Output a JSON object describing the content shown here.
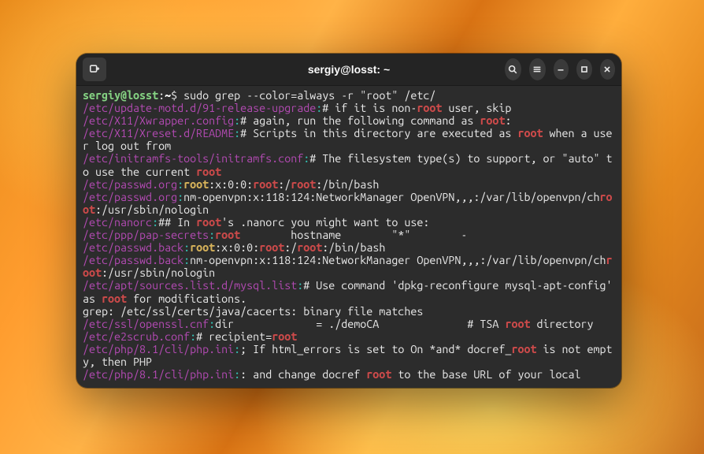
{
  "titlebar": {
    "title": "sergiy@losst: ~"
  },
  "prompt": {
    "user_host": "sergiy@losst",
    "separator": ":",
    "path": "~",
    "symbol": "$",
    "command": "sudo grep --color=always -r \"root\" /etc/"
  },
  "lines": [
    {
      "file": "/etc/update-motd.d/91-release-upgrade",
      "segments": [
        {
          "t": "# if it is non-",
          "c": "w"
        },
        {
          "t": "root",
          "c": "rb"
        },
        {
          "t": " user, skip",
          "c": "w"
        }
      ]
    },
    {
      "file": "/etc/X11/Xwrapper.config",
      "segments": [
        {
          "t": "# again, run the following command as ",
          "c": "w"
        },
        {
          "t": "root",
          "c": "rb"
        },
        {
          "t": ":",
          "c": "w"
        }
      ]
    },
    {
      "file": "/etc/X11/Xreset.d/README",
      "segments": [
        {
          "t": "# Scripts in this directory are executed as ",
          "c": "w"
        },
        {
          "t": "root",
          "c": "rb"
        },
        {
          "t": " when a user log out from",
          "c": "w"
        }
      ]
    },
    {
      "file": "/etc/initramfs-tools/initramfs.conf",
      "segments": [
        {
          "t": "# The filesystem type(s) to support, or \"auto\" to use the current ",
          "c": "w"
        },
        {
          "t": "root",
          "c": "rb"
        }
      ]
    },
    {
      "file": "/etc/passwd.org",
      "segments": [
        {
          "t": "root",
          "c": "yb"
        },
        {
          "t": ":x:0:0:",
          "c": "w"
        },
        {
          "t": "root",
          "c": "rb"
        },
        {
          "t": ":/",
          "c": "w"
        },
        {
          "t": "root",
          "c": "rb"
        },
        {
          "t": ":/bin/bash",
          "c": "w"
        }
      ]
    },
    {
      "file": "/etc/passwd.org",
      "segments": [
        {
          "t": "nm-openvpn:x:118:124:NetworkManager OpenVPN,,,:/var/lib/openvpn/ch",
          "c": "w"
        },
        {
          "t": "root",
          "c": "rb"
        },
        {
          "t": ":/usr/sbin/nologin",
          "c": "w"
        }
      ]
    },
    {
      "file": "/etc/nanorc",
      "segments": [
        {
          "t": "## In ",
          "c": "w"
        },
        {
          "t": "root",
          "c": "rb"
        },
        {
          "t": "'s .nanorc you might want to use:",
          "c": "w"
        }
      ]
    },
    {
      "file": "/etc/ppp/pap-secrets",
      "segments": [
        {
          "t": "root",
          "c": "rb"
        },
        {
          "t": "        hostname        \"*\"        -",
          "c": "w"
        }
      ]
    },
    {
      "file": "/etc/passwd.back",
      "segments": [
        {
          "t": "root",
          "c": "yb"
        },
        {
          "t": ":x:0:0:",
          "c": "w"
        },
        {
          "t": "root",
          "c": "rb"
        },
        {
          "t": ":/",
          "c": "w"
        },
        {
          "t": "root",
          "c": "rb"
        },
        {
          "t": ":/bin/bash",
          "c": "w"
        }
      ]
    },
    {
      "file": "/etc/passwd.back",
      "segments": [
        {
          "t": "nm-openvpn:x:118:124:NetworkManager OpenVPN,,,:/var/lib/openvpn/ch",
          "c": "w"
        },
        {
          "t": "root",
          "c": "rb"
        },
        {
          "t": ":/usr/sbin/nologin",
          "c": "w"
        }
      ]
    },
    {
      "file": "/etc/apt/sources.list.d/mysql.list",
      "segments": [
        {
          "t": "# Use command 'dpkg-reconfigure mysql-apt-config' as ",
          "c": "w"
        },
        {
          "t": "root",
          "c": "rb"
        },
        {
          "t": " for modifications.",
          "c": "w"
        }
      ]
    },
    {
      "plain": "grep: /etc/ssl/certs/java/cacerts: binary file matches"
    },
    {
      "file": "/etc/ssl/openssl.cnf",
      "segments": [
        {
          "t": "dir             = ./demoCA              # TSA ",
          "c": "w"
        },
        {
          "t": "root",
          "c": "rb"
        },
        {
          "t": " directory",
          "c": "w"
        }
      ]
    },
    {
      "file": "/etc/e2scrub.conf",
      "segments": [
        {
          "t": "# recipient=",
          "c": "w"
        },
        {
          "t": "root",
          "c": "rb"
        }
      ]
    },
    {
      "file": "/etc/php/8.1/cli/php.ini",
      "segments": [
        {
          "t": "; If html_errors is set to On *and* docref_",
          "c": "w"
        },
        {
          "t": "root",
          "c": "rb"
        },
        {
          "t": " is not empty, then PHP",
          "c": "w"
        }
      ]
    },
    {
      "file": "/etc/php/8.1/cli/php.ini",
      "segments": [
        {
          "t": ": and change docref ",
          "c": "w"
        },
        {
          "t": "root",
          "c": "rb"
        },
        {
          "t": " to the base URL of your local",
          "c": "w"
        }
      ]
    }
  ]
}
